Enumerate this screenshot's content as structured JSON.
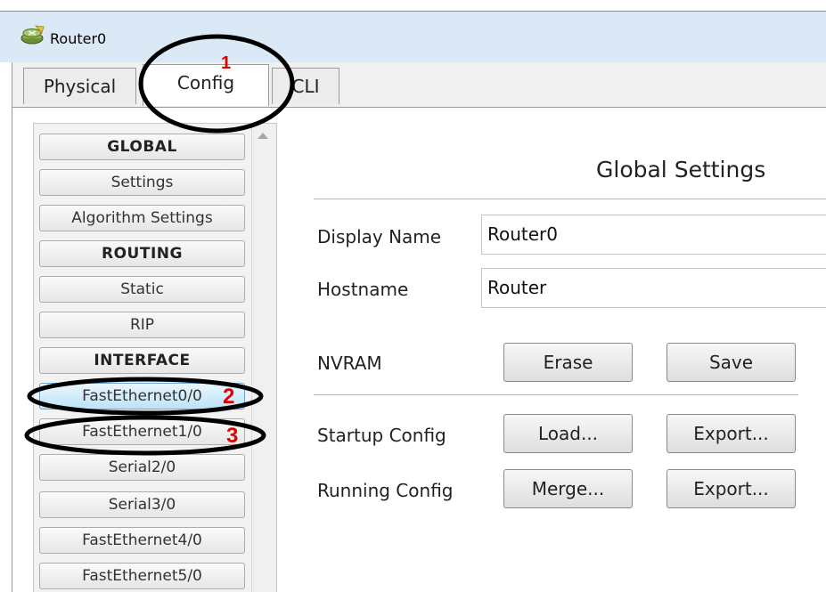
{
  "window": {
    "title": "Router0",
    "icon": "router-icon"
  },
  "tabs": [
    {
      "label": "Physical",
      "active": false
    },
    {
      "label": "Config",
      "active": true
    },
    {
      "label": "CLI",
      "active": false
    }
  ],
  "sidebar": {
    "items": [
      {
        "label": "GLOBAL",
        "type": "header"
      },
      {
        "label": "Settings",
        "type": "item"
      },
      {
        "label": "Algorithm Settings",
        "type": "item"
      },
      {
        "label": "ROUTING",
        "type": "header"
      },
      {
        "label": "Static",
        "type": "item"
      },
      {
        "label": "RIP",
        "type": "item"
      },
      {
        "label": "INTERFACE",
        "type": "header"
      },
      {
        "label": "FastEthernet0/0",
        "type": "item",
        "active": true
      },
      {
        "label": "FastEthernet1/0",
        "type": "item"
      },
      {
        "label": "Serial2/0",
        "type": "item"
      },
      {
        "label": "Serial3/0",
        "type": "item"
      },
      {
        "label": "FastEthernet4/0",
        "type": "item"
      },
      {
        "label": "FastEthernet5/0",
        "type": "item"
      }
    ]
  },
  "main": {
    "title": "Global Settings",
    "display_name_label": "Display Name",
    "display_name_value": "Router0",
    "hostname_label": "Hostname",
    "hostname_value": "Router",
    "nvram_label": "NVRAM",
    "erase_label": "Erase",
    "save_label": "Save",
    "startup_config_label": "Startup Config",
    "startup_load_label": "Load...",
    "startup_export_label": "Export...",
    "running_config_label": "Running Config",
    "running_merge_label": "Merge...",
    "running_export_label": "Export..."
  },
  "annotations": {
    "n1": "1",
    "n2": "2",
    "n3": "3",
    "color": "#e00000"
  },
  "colors": {
    "titlebar": "#dbe8f6",
    "active_item": "#bde3f8"
  }
}
